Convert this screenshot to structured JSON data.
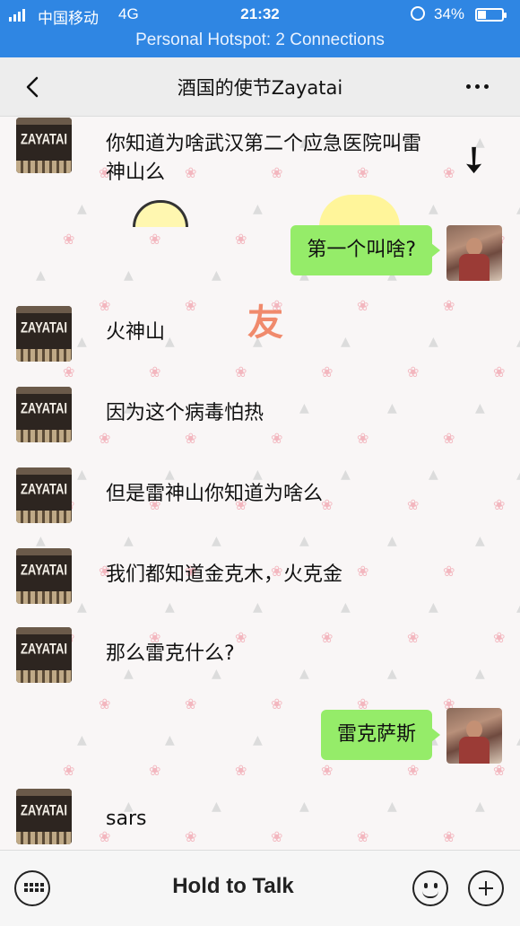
{
  "status_bar": {
    "carrier": "中国移动",
    "network": "4G",
    "time": "21:32",
    "battery_percent_text": "34%",
    "battery_level": 0.34,
    "hotspot": "Personal Hotspot: 2 Connections"
  },
  "header": {
    "title": "酒国的使节Zayatai",
    "back_icon": "chevron-left-icon",
    "more_icon": "more-dots-icon"
  },
  "contact_avatar_text": "ZAYATAI",
  "background_sticker_text": "友",
  "messages": [
    {
      "sender": "contact",
      "text": "你知道为啥武汉第二个应急医院叫雷神山么"
    },
    {
      "sender": "me",
      "text": "第一个叫啥?"
    },
    {
      "sender": "contact",
      "text": "火神山"
    },
    {
      "sender": "contact",
      "text": "因为这个病毒怕热"
    },
    {
      "sender": "contact",
      "text": "但是雷神山你知道为啥么"
    },
    {
      "sender": "contact",
      "text": "我们都知道金克木，火克金"
    },
    {
      "sender": "contact",
      "text": "那么雷克什么?"
    },
    {
      "sender": "me",
      "text": "雷克萨斯"
    },
    {
      "sender": "contact",
      "text": "sars"
    }
  ],
  "input_bar": {
    "voice_label": "Hold to Talk",
    "keyboard_icon": "keyboard-icon",
    "emoji_icon": "emoji-icon",
    "plus_icon": "plus-icon"
  },
  "colors": {
    "status_bar_bg": "#2f86e3",
    "nav_bg": "#ededed",
    "outgoing_bubble": "#95ec69"
  }
}
